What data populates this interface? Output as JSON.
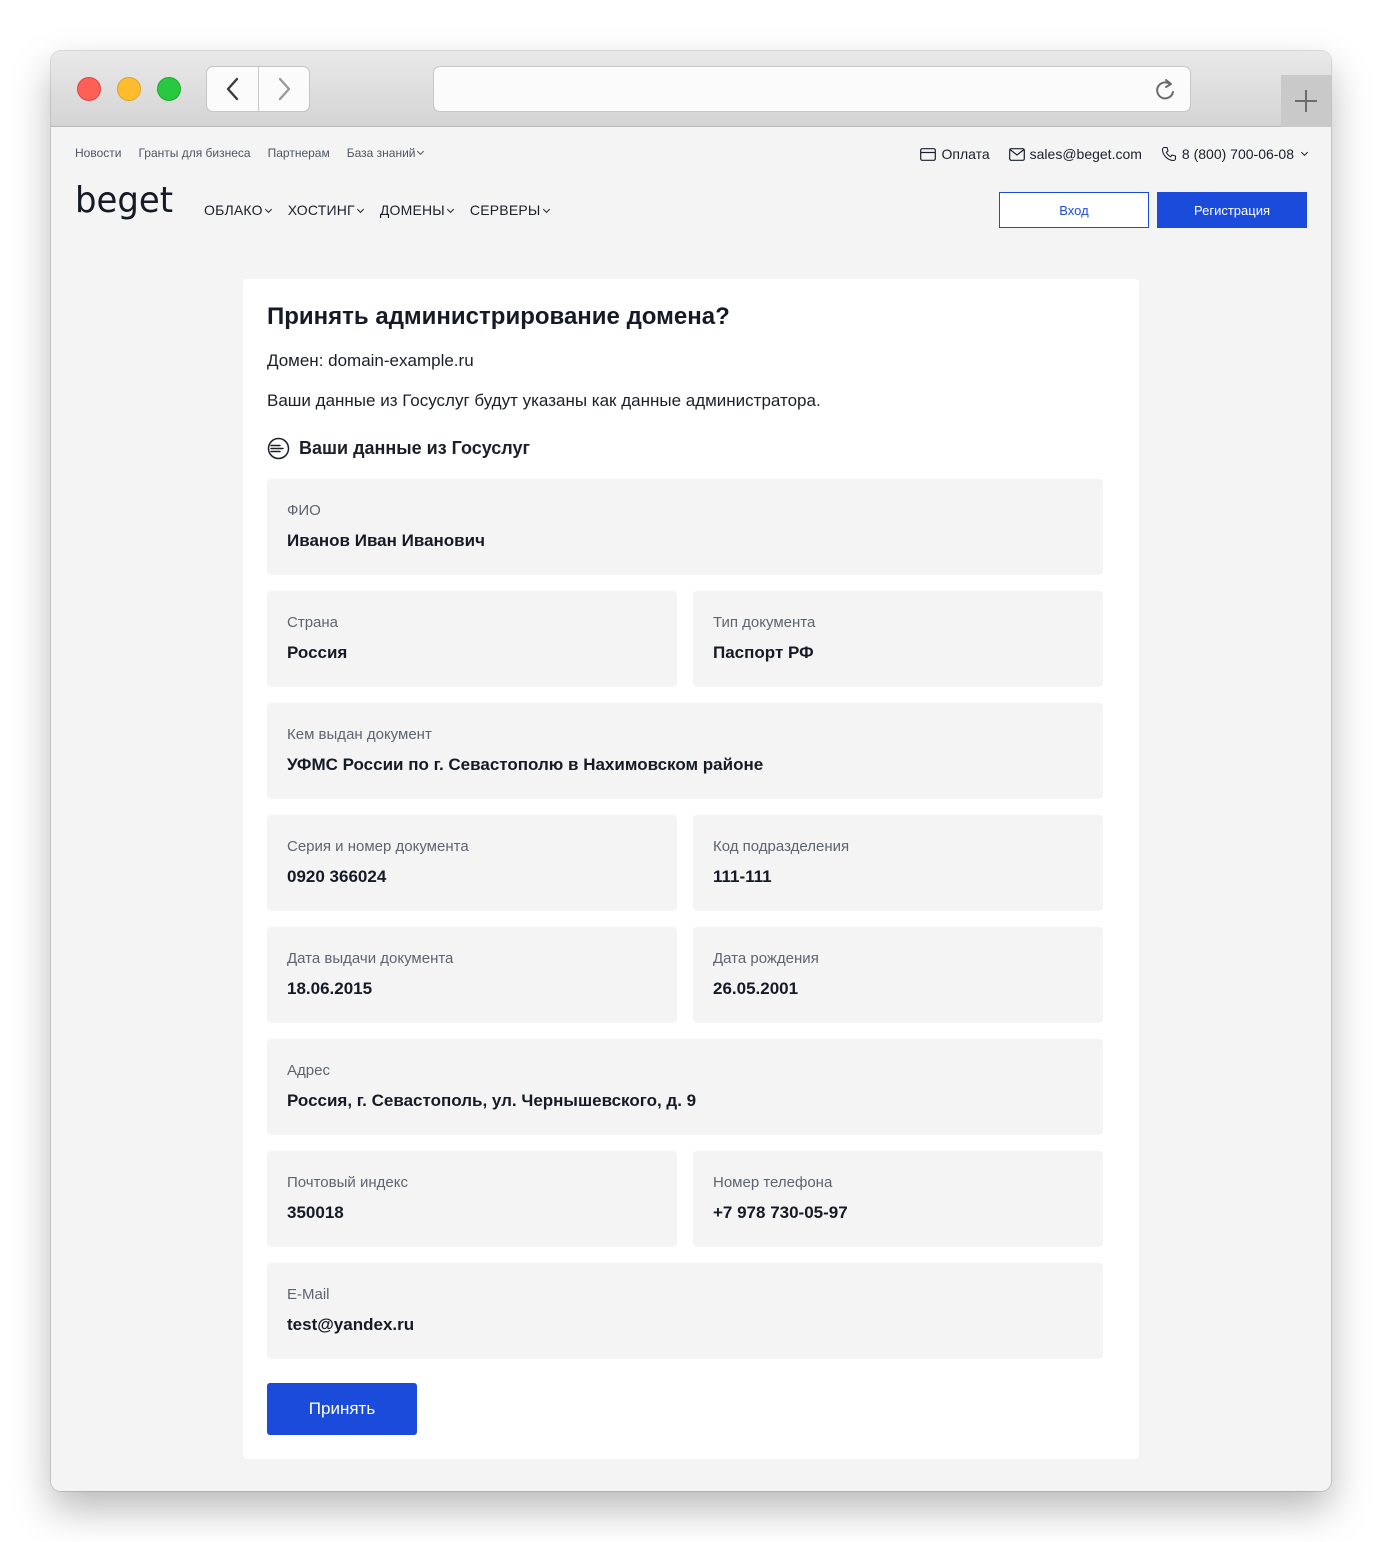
{
  "topbar": {
    "links": [
      "Новости",
      "Гранты для бизнеса",
      "Партнерам",
      "База знаний"
    ],
    "payment": "Оплата",
    "email": "sales@beget.com",
    "phone": "8 (800) 700-06-08"
  },
  "nav": {
    "logo_text": "beget",
    "menu": [
      "ОБЛАКО",
      "ХОСТИНГ",
      "ДОМЕНЫ",
      "СЕРВЕРЫ"
    ],
    "login": "Вход",
    "register": "Регистрация"
  },
  "card": {
    "title": "Принять администрирование домена?",
    "domain_line": "Домен: domain-example.ru",
    "description": "Ваши данные из Госуслуг будут указаны как данные администратора.",
    "section_title": "Ваши данные из Госуслуг",
    "fields": {
      "fio": {
        "label": "ФИО",
        "value": "Иванов Иван Иванович"
      },
      "country": {
        "label": "Страна",
        "value": "Россия"
      },
      "doc_type": {
        "label": "Тип документа",
        "value": "Паспорт РФ"
      },
      "issued_by": {
        "label": "Кем выдан документ",
        "value": "УФМС России по г. Севастополю в Нахимовском районе"
      },
      "doc_number": {
        "label": "Серия и номер документа",
        "value": "0920 366024"
      },
      "division_code": {
        "label": "Код подразделения",
        "value": "111-111"
      },
      "issue_date": {
        "label": "Дата выдачи документа",
        "value": "18.06.2015"
      },
      "birth_date": {
        "label": "Дата рождения",
        "value": "26.05.2001"
      },
      "address": {
        "label": "Адрес",
        "value": "Россия, г. Севастополь, ул. Чернышевского, д. 9"
      },
      "postal_code": {
        "label": "Почтовый индекс",
        "value": "350018"
      },
      "phone": {
        "label": "Номер телефона",
        "value": "+7 978 730-05-97"
      },
      "email": {
        "label": "E-Mail",
        "value": "test@yandex.ru"
      }
    },
    "accept_button": "Принять"
  },
  "colors": {
    "accent": "#1a4bdb",
    "page_bg": "#f4f4f4",
    "field_bg": "#f4f4f4"
  }
}
